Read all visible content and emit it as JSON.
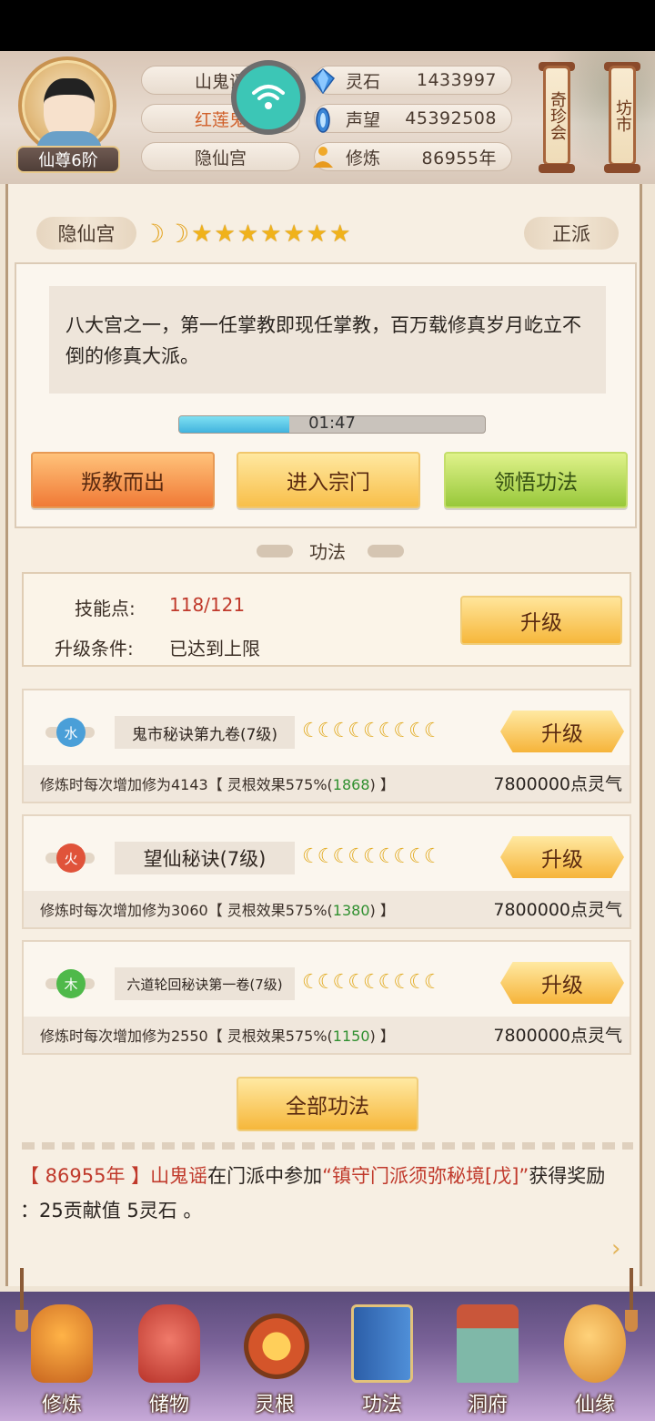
{
  "header": {
    "rank": "仙尊6阶",
    "name": "山鬼谣",
    "title": "红莲鬼",
    "sect": "隐仙宫",
    "stats": [
      {
        "label": "灵石",
        "value": "1433997",
        "icon": "crystal-icon"
      },
      {
        "label": "声望",
        "value": "45392508",
        "icon": "prestige-icon"
      },
      {
        "label": "修炼",
        "value": "86955年",
        "icon": "meditate-icon"
      }
    ],
    "shops": [
      "奇珍会",
      "坊市"
    ]
  },
  "sect_panel": {
    "name": "隐仙宫",
    "alignment": "正派",
    "moons": 2,
    "stars": 7,
    "description": "八大宫之一，第一任掌教即现任掌教，百万载修真岁月屹立不倒的修真大派。",
    "timer": "01:47",
    "progress": 0.36,
    "buttons": [
      "叛教而出",
      "进入宗门",
      "领悟功法"
    ]
  },
  "skills": {
    "section_title": "功法",
    "points_label": "技能点:",
    "points_value": "118/121",
    "cond_label": "升级条件:",
    "cond_value": "已达到上限",
    "upgrade_label": "升级"
  },
  "techniques": [
    {
      "element": "水",
      "element_color": "#4a9fd8",
      "name": "鬼市秘诀第九卷(7级)",
      "moons": 9,
      "desc_pre": "修炼时每次增加修为4143【 灵根效果575%(",
      "bonus": "1868",
      "desc_post": ") 】",
      "cost": "7800000点灵气",
      "button": "升级"
    },
    {
      "element": "火",
      "element_color": "#e0533a",
      "name": "望仙秘诀(7级)",
      "moons": 9,
      "desc_pre": "修炼时每次增加修为3060【 灵根效果575%(",
      "bonus": "1380",
      "desc_post": ") 】",
      "cost": "7800000点灵气",
      "button": "升级"
    },
    {
      "element": "木",
      "element_color": "#4fb94a",
      "name": "六道轮回秘诀第一卷(7级)",
      "moons": 9,
      "desc_pre": "修炼时每次增加修为2550【 灵根效果575%(",
      "bonus": "1150",
      "desc_post": ") 】",
      "cost": "7800000点灵气",
      "button": "升级"
    }
  ],
  "all_button": "全部功法",
  "log": {
    "year": "【 86955年 】",
    "player": "山鬼谣",
    "mid": "在门派中参加",
    "event": "“镇守门派须弥秘境[戊]”",
    "reward_pre": "获得奖励",
    "reward": "：25贡献值 5灵石 。"
  },
  "nav": [
    "修炼",
    "储物",
    "灵根",
    "功法",
    "洞府",
    "仙缘"
  ],
  "colors": {
    "gold": "#f0b21a",
    "accent_red": "#c0392b",
    "bonus_green": "#2f8f2f"
  }
}
